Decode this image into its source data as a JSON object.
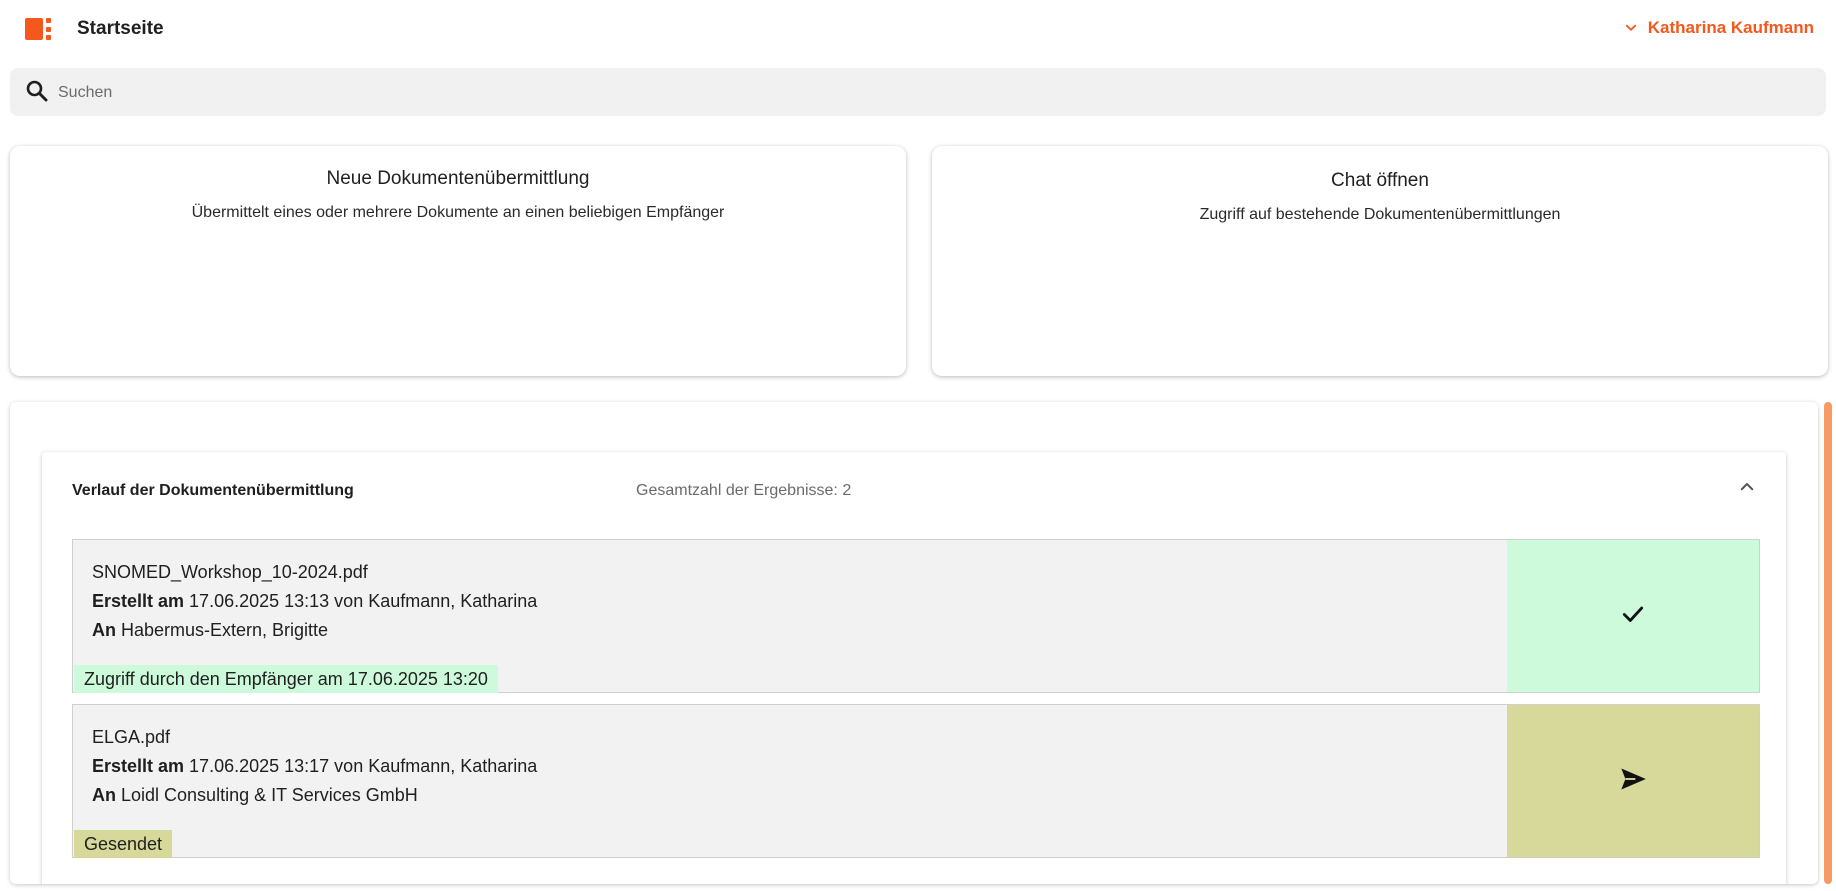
{
  "header": {
    "app_title": "Startseite",
    "user_name": "Katharina Kaufmann"
  },
  "search": {
    "placeholder": "Suchen",
    "value": ""
  },
  "cards": [
    {
      "title": "Neue Dokumentenübermittlung",
      "description": "Übermittelt eines oder mehrere Dokumente an einen beliebigen Empfänger"
    },
    {
      "title": "Chat öffnen",
      "description": "Zugriff auf bestehende Dokumentenübermittlungen"
    }
  ],
  "history": {
    "title": "Verlauf der Dokumentenübermittlung",
    "count_label": "Gesamtzahl der Ergebnisse: ",
    "count": "2",
    "entries": [
      {
        "filename": "SNOMED_Workshop_10-2024.pdf",
        "created_label": "Erstellt am",
        "created_text": " 17.06.2025 13:13 von Kaufmann, Katharina",
        "to_label": "An",
        "to_text": " Habermus-Extern, Brigitte",
        "status_text": "Zugriff durch den Empfänger am 17.06.2025 13:20",
        "status_icon": "check-icon",
        "status_color": "#ccfadb"
      },
      {
        "filename": "ELGA.pdf",
        "created_label": "Erstellt am",
        "created_text": " 17.06.2025 13:17 von Kaufmann, Katharina",
        "to_label": "An",
        "to_text": " Loidl Consulting & IT Services GmbH",
        "status_text": "Gesendet",
        "status_icon": "send-icon",
        "status_color": "#d6d99a"
      }
    ]
  },
  "colors": {
    "accent": "#f4581c",
    "search_bg": "#f1f1f1",
    "entry_bg": "#f2f2f2",
    "scrollbar": "#f69a66"
  }
}
